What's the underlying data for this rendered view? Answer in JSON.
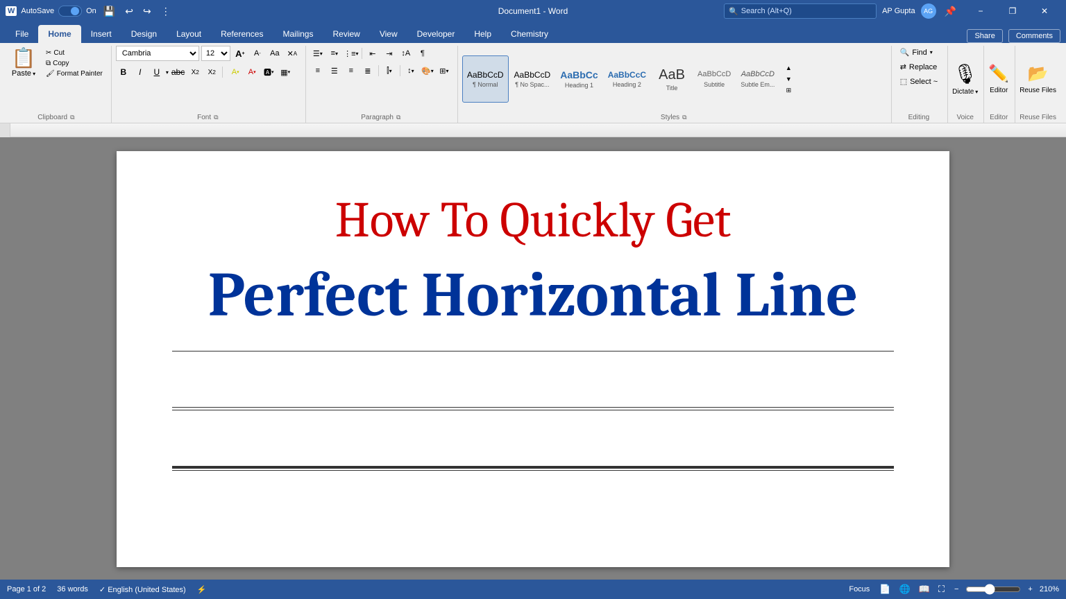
{
  "titlebar": {
    "autosave": "AutoSave",
    "autosave_state": "On",
    "doc_title": "Document1 - Word",
    "search_placeholder": "Search (Alt+Q)",
    "user_name": "AP Gupta",
    "user_initials": "AG",
    "minimize": "−",
    "restore": "❐",
    "close": "✕"
  },
  "ribbon_tabs": {
    "tabs": [
      "File",
      "Home",
      "Insert",
      "Design",
      "Layout",
      "References",
      "Mailings",
      "Review",
      "View",
      "Developer",
      "Help",
      "Chemistry"
    ],
    "active": "Home"
  },
  "ribbon_tabs_right": {
    "share": "Share",
    "comments": "Comments"
  },
  "clipboard": {
    "paste_label": "Paste",
    "cut_label": "Cut",
    "copy_label": "Copy",
    "format_painter_label": "Format Painter",
    "group_label": "Clipboard"
  },
  "font": {
    "font_name": "Cambria",
    "font_size": "12",
    "grow_label": "A",
    "shrink_label": "A",
    "clear_label": "✕",
    "bold_label": "B",
    "italic_label": "I",
    "underline_label": "U",
    "strikethrough_label": "abc",
    "subscript_label": "X₂",
    "superscript_label": "X²",
    "highlight_label": "A",
    "color_label": "A",
    "group_label": "Font"
  },
  "paragraph": {
    "group_label": "Paragraph"
  },
  "styles": {
    "group_label": "Styles",
    "items": [
      {
        "preview": "AaBbCcD",
        "name": "¶ Normal",
        "active": true
      },
      {
        "preview": "AaBbCcD",
        "name": "¶ No Spac..."
      },
      {
        "preview": "AaBbCc",
        "name": "Heading 1"
      },
      {
        "preview": "AaBbCcC",
        "name": "Heading 2"
      },
      {
        "preview": "AaB",
        "name": "Title"
      },
      {
        "preview": "AaBbCcD",
        "name": "Subtitle"
      },
      {
        "preview": "AaBbCcD",
        "name": "Subtle Em..."
      }
    ]
  },
  "editing": {
    "find_label": "Find",
    "replace_label": "Replace",
    "select_label": "Select ~",
    "group_label": "Editing"
  },
  "voice": {
    "dictate_label": "Dictate",
    "group_label": "Voice"
  },
  "editor": {
    "editor_label": "Editor",
    "group_label": "Editor"
  },
  "reuse": {
    "reuse_label": "Reuse Files",
    "group_label": "Reuse Files"
  },
  "document": {
    "title_red": "How To Quickly Get",
    "title_blue": "Perfect Horizontal Line"
  },
  "statusbar": {
    "page_info": "Page 1 of 2",
    "words": "36 words",
    "language": "English (United States)",
    "focus_label": "Focus",
    "zoom_level": "210%"
  }
}
